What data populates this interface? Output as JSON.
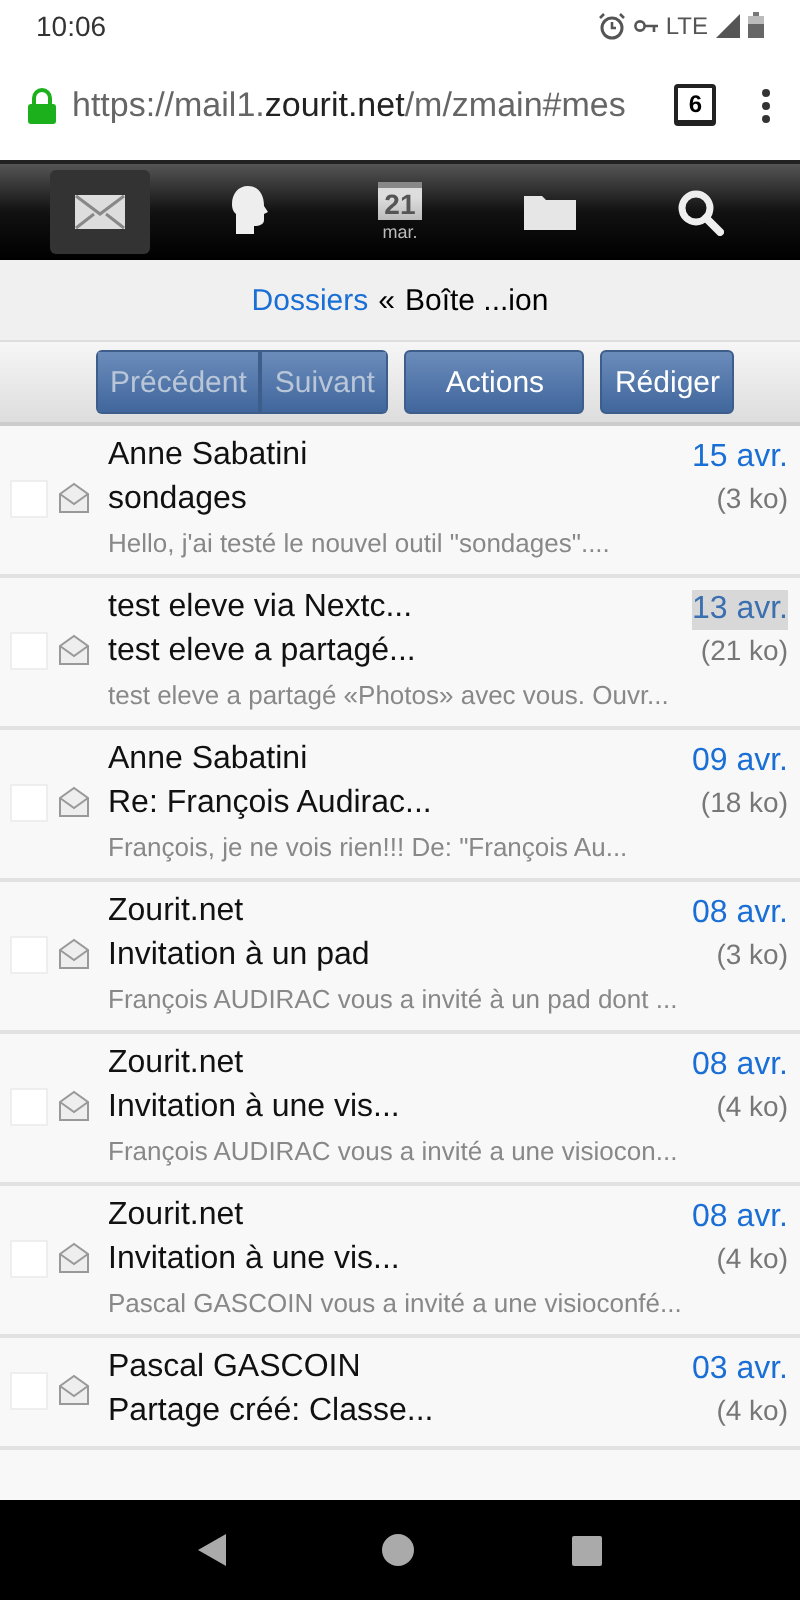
{
  "status_bar": {
    "time": "10:06",
    "network": "LTE"
  },
  "address_bar": {
    "url_prefix": "https://mail1.",
    "url_domain": "zourit.net",
    "url_path": "/m/zmain#mes",
    "tab_count": "6"
  },
  "app_nav": [
    {
      "kind": "mail",
      "selected": true
    },
    {
      "kind": "contacts",
      "selected": false
    },
    {
      "kind": "calendar",
      "selected": false,
      "day": "21",
      "label": "mar."
    },
    {
      "kind": "folder",
      "selected": false
    },
    {
      "kind": "search",
      "selected": false
    }
  ],
  "breadcrumb": {
    "link": "Dossiers",
    "separator": "«",
    "current": "Boîte ...ion"
  },
  "toolbar": {
    "pager": [
      {
        "label": "Précédent",
        "disabled": true
      },
      {
        "label": "Suivant",
        "disabled": true
      }
    ],
    "actions": "Actions",
    "compose": "Rédiger"
  },
  "messages": [
    {
      "from": "Anne Sabatini",
      "subject": "sondages",
      "preview": "Hello, j'ai testé le nouvel outil \"sondages\"....",
      "date": "15 avr.",
      "size": "(3 ko)",
      "checked": false,
      "focused": false
    },
    {
      "from": "test eleve via Nextc...",
      "subject": "test eleve a partagé...",
      "preview": "test eleve a partagé «Photos» avec vous. Ouvr...",
      "date": "13 avr.",
      "size": "(21 ko)",
      "checked": false,
      "focused": true
    },
    {
      "from": "Anne Sabatini",
      "subject": "Re: François Audirac...",
      "preview": "François, je ne vois rien!!! De: \"François Au...",
      "date": "09 avr.",
      "size": "(18 ko)",
      "checked": false,
      "focused": false
    },
    {
      "from": "Zourit.net",
      "subject": "Invitation à un pad",
      "preview": "François AUDIRAC vous a invité à un pad dont ...",
      "date": "08 avr.",
      "size": "(3 ko)",
      "checked": false,
      "focused": false
    },
    {
      "from": "Zourit.net",
      "subject": "Invitation à une vis...",
      "preview": "François AUDIRAC vous a invité a une visiocon...",
      "date": "08 avr.",
      "size": "(4 ko)",
      "checked": false,
      "focused": false
    },
    {
      "from": "Zourit.net",
      "subject": "Invitation à une vis...",
      "preview": "Pascal GASCOIN vous a invité a une visioconfé...",
      "date": "08 avr.",
      "size": "(4 ko)",
      "checked": false,
      "focused": false
    },
    {
      "from": "Pascal GASCOIN",
      "subject": "Partage créé: Classe...",
      "date": "03 avr.",
      "size": "(4 ko)",
      "checked": false,
      "focused": false
    }
  ]
}
